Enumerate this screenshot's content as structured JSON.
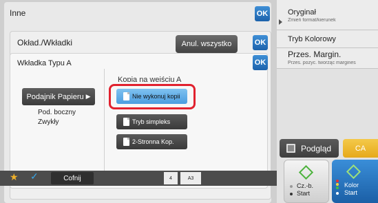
{
  "layer1": {
    "title": "Inne",
    "ok": "OK"
  },
  "layer2": {
    "title": "Okład./Wkładki",
    "ok": "OK",
    "cancel_all": "Anul. wszystko"
  },
  "layer3": {
    "title": "Wkładka Typu A",
    "ok": "OK",
    "paper_button": "Podajnik Papieru",
    "paper_arrow": "▶",
    "paper_tray": "Pod. boczny",
    "paper_type": "Zwykły",
    "group_label": "Kopia na wejściu A",
    "options": [
      "Nie wykonuj kopii",
      "Tryb simpleks",
      "2-Stronna Kop."
    ],
    "selected_index": 0
  },
  "right_panel": {
    "original_title": "Oryginał",
    "original_sub": "Zmień format/kierunek",
    "color_mode": "Tryb Kolorowy",
    "margin_title": "Przes. Margin.",
    "margin_sub": "Przes. pozyc. tworząc margines"
  },
  "preview_label": "Podgląd",
  "ca_label": "CA",
  "start_bw": {
    "line1": "Cz.-b.",
    "line2": "Start"
  },
  "start_color": {
    "line1": "Kolor",
    "line2": "Start"
  },
  "bottom_bar": {
    "back_label": "Cofnij",
    "page_num": "4",
    "paper_size": "A3"
  },
  "colors": {
    "accent_blue": "#1c62ab",
    "selected_blue": "#6db6ee",
    "highlight_red": "#e1212e",
    "ca_yellow": "#f0b72c"
  }
}
